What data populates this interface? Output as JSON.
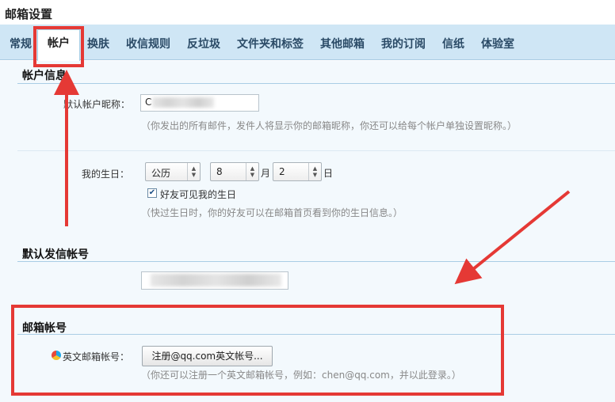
{
  "page": {
    "title": "邮箱设置"
  },
  "tabs": [
    {
      "label": "常规",
      "active": false
    },
    {
      "label": "帐户",
      "active": true
    },
    {
      "label": "换肤",
      "active": false
    },
    {
      "label": "收信规则",
      "active": false
    },
    {
      "label": "反垃圾",
      "active": false
    },
    {
      "label": "文件夹和标签",
      "active": false
    },
    {
      "label": "其他邮箱",
      "active": false
    },
    {
      "label": "我的订阅",
      "active": false
    },
    {
      "label": "信纸",
      "active": false
    },
    {
      "label": "体验室",
      "active": false
    }
  ],
  "account_info": {
    "title": "帐户信息",
    "nickname_label": "默认帐户昵称：",
    "nickname_value": "C",
    "nickname_hint": "（你发出的所有邮件，发件人将显示你的邮箱昵称，你还可以给每个帐户单独设置昵称。）",
    "birthday_label": "我的生日：",
    "calendar_type": "公历",
    "month": "8",
    "month_unit": "月",
    "day": "2",
    "day_unit": "日",
    "friends_see_birthday_label": "好友可见我的生日",
    "friends_see_birthday_checked": true,
    "birthday_hint": "（快过生日时，你的好友可以在邮箱首页看到你的生日信息。）"
  },
  "default_sender": {
    "title": "默认发信帐号"
  },
  "mail_account": {
    "title": "邮箱帐号",
    "english_account_label": "英文邮箱帐号：",
    "register_button": "注册@qq.com英文帐号...",
    "hint": "（你还可以注册一个英文邮箱帐号，例如：chen@qq.com，并以此登录。）"
  },
  "colors": {
    "tab_bar": "#cfe6f5",
    "content_bg": "#f3f9fd",
    "annotation_red": "#e53935"
  }
}
